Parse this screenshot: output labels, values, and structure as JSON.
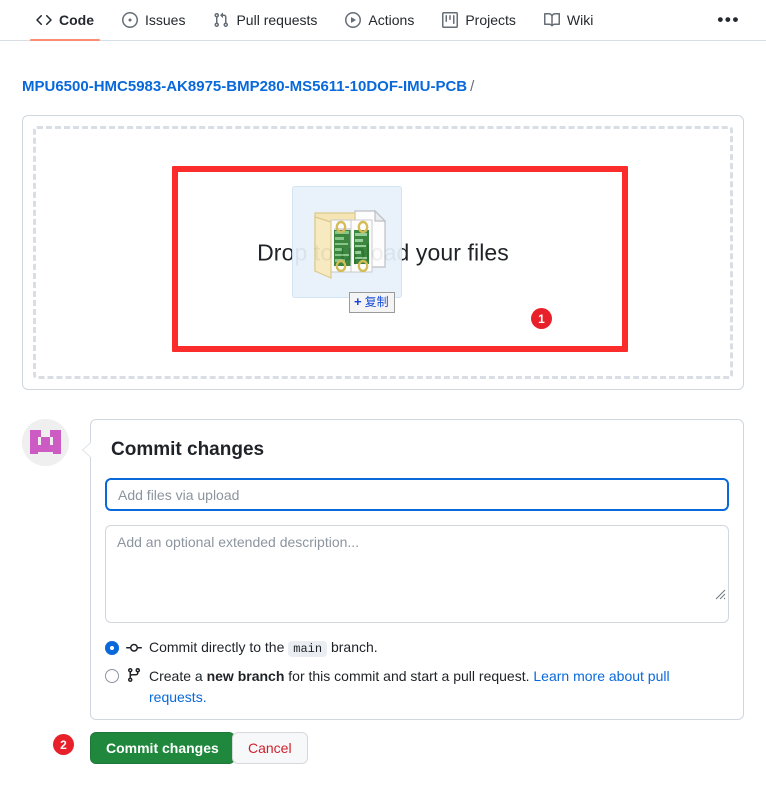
{
  "nav": {
    "tabs": [
      {
        "label": "Code",
        "icon": "code-icon",
        "active": true
      },
      {
        "label": "Issues",
        "icon": "issue-opened-icon",
        "active": false
      },
      {
        "label": "Pull requests",
        "icon": "git-pull-request-icon",
        "active": false
      },
      {
        "label": "Actions",
        "icon": "play-icon",
        "active": false
      },
      {
        "label": "Projects",
        "icon": "project-icon",
        "active": false
      },
      {
        "label": "Wiki",
        "icon": "book-icon",
        "active": false
      }
    ],
    "overflow_label": "•••"
  },
  "breadcrumb": {
    "repo": "MPU6500-HMC5983-AK8975-BMP280-MS5611-10DOF-IMU-PCB",
    "separator": "/"
  },
  "dropzone": {
    "message": "Drop to upload your files"
  },
  "drag_ghost": {
    "tooltip_plus": "+",
    "tooltip_label": "复制"
  },
  "annotations": [
    {
      "id": "1",
      "label": "1"
    },
    {
      "id": "2",
      "label": "2"
    }
  ],
  "commit": {
    "title": "Commit changes",
    "message_value": "",
    "message_placeholder": "Add files via upload",
    "description_value": "",
    "description_placeholder": "Add an optional extended description...",
    "options": {
      "direct": {
        "text_before": "Commit directly to the",
        "branch": "main",
        "text_after": "branch.",
        "selected": true
      },
      "new_branch": {
        "text_before": "Create a",
        "emphasis": "new branch",
        "text_after": "for this commit and start a pull request.",
        "link": "Learn more about pull requests.",
        "selected": false
      }
    },
    "submit_label": "Commit changes",
    "cancel_label": "Cancel"
  },
  "colors": {
    "accent": "#0969da",
    "active_tab_underline": "#fd8c73",
    "success": "#1f883d",
    "danger": "#cf222e",
    "annotation_red": "#fb2c2c"
  }
}
